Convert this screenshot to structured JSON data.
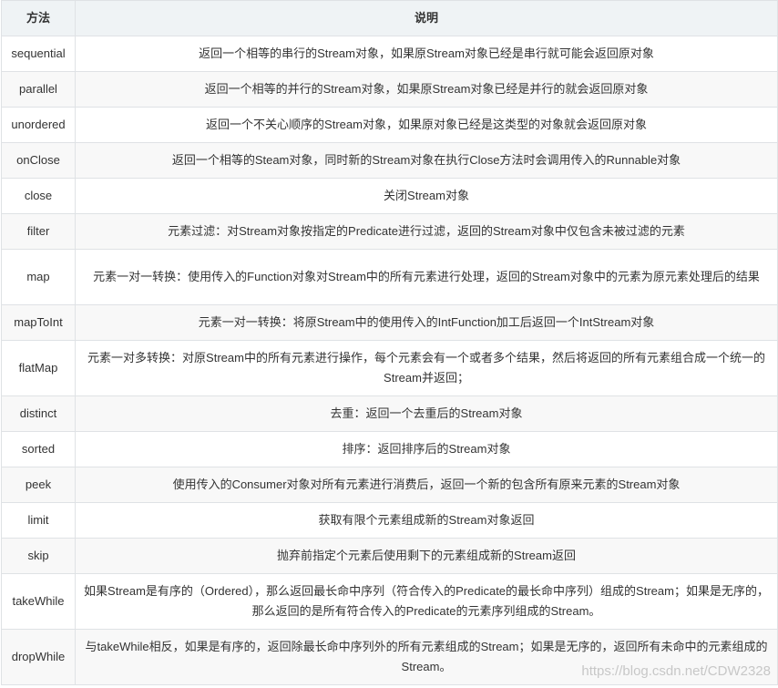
{
  "table": {
    "headers": [
      "方法",
      "说明"
    ],
    "rows": [
      {
        "method": "sequential",
        "desc": "返回一个相等的串行的Stream对象，如果原Stream对象已经是串行就可能会返回原对象"
      },
      {
        "method": "parallel",
        "desc": "返回一个相等的并行的Stream对象，如果原Stream对象已经是并行的就会返回原对象"
      },
      {
        "method": "unordered",
        "desc": "返回一个不关心顺序的Stream对象，如果原对象已经是这类型的对象就会返回原对象"
      },
      {
        "method": "onClose",
        "desc": "返回一个相等的Steam对象，同时新的Stream对象在执行Close方法时会调用传入的Runnable对象"
      },
      {
        "method": "close",
        "desc": "关闭Stream对象"
      },
      {
        "method": "filter",
        "desc": "元素过滤：对Stream对象按指定的Predicate进行过滤，返回的Stream对象中仅包含未被过滤的元素"
      },
      {
        "method": "map",
        "desc": "元素一对一转换：使用传入的Function对象对Stream中的所有元素进行处理，返回的Stream对象中的元素为原元素处理后的结果"
      },
      {
        "method": "mapToInt",
        "desc": "元素一对一转换：将原Stream中的使用传入的IntFunction加工后返回一个IntStream对象"
      },
      {
        "method": "flatMap",
        "desc": "元素一对多转换：对原Stream中的所有元素进行操作，每个元素会有一个或者多个结果，然后将返回的所有元素组合成一个统一的Stream并返回；"
      },
      {
        "method": "distinct",
        "desc": "去重：返回一个去重后的Stream对象"
      },
      {
        "method": "sorted",
        "desc": "排序：返回排序后的Stream对象"
      },
      {
        "method": "peek",
        "desc": "使用传入的Consumer对象对所有元素进行消费后，返回一个新的包含所有原来元素的Stream对象"
      },
      {
        "method": "limit",
        "desc": "获取有限个元素组成新的Stream对象返回"
      },
      {
        "method": "skip",
        "desc": "抛弃前指定个元素后使用剩下的元素组成新的Stream返回"
      },
      {
        "method": "takeWhile",
        "desc": "如果Stream是有序的（Ordered），那么返回最长命中序列（符合传入的Predicate的最长命中序列）组成的Stream；如果是无序的，那么返回的是所有符合传入的Predicate的元素序列组成的Stream。"
      },
      {
        "method": "dropWhile",
        "desc": "与takeWhile相反，如果是有序的，返回除最长命中序列外的所有元素组成的Stream；如果是无序的，返回所有未命中的元素组成的Stream。"
      }
    ]
  },
  "watermark": "https://blog.csdn.net/CDW2328"
}
